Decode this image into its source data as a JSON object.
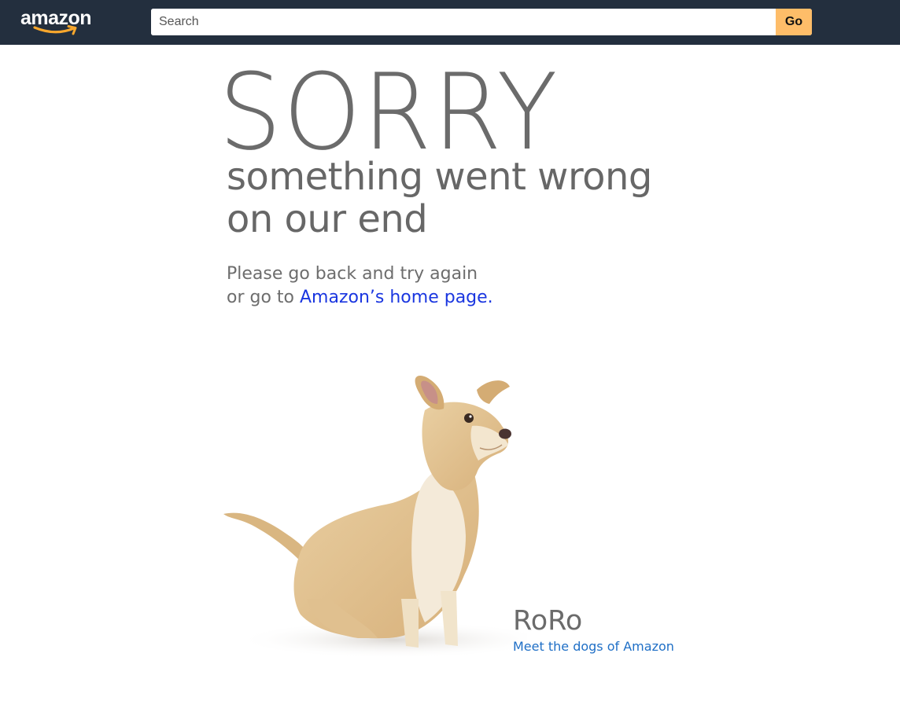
{
  "header": {
    "logo_text": "amazon",
    "search": {
      "placeholder": "Search",
      "value": ""
    },
    "go_label": "Go"
  },
  "error": {
    "headline": "SORRY",
    "subtitle_line1": "something went wrong",
    "subtitle_line2": "on our end",
    "instruction_line1": "Please go back and try again",
    "instruction_line2_prefix": "or go to ",
    "home_link": "Amazon’s home page."
  },
  "dog": {
    "name": "RoRo",
    "link": "Meet the dogs of Amazon"
  },
  "colors": {
    "header_bg": "#232f3e",
    "go_button": "#febd69",
    "logo_smile": "#f7a72d",
    "link_blue": "#1a36e0",
    "text_gray": "#6b6b6b"
  },
  "icons": {
    "logo_smile": "amazon-smile-arrow-icon",
    "dog": "dog-photo"
  }
}
